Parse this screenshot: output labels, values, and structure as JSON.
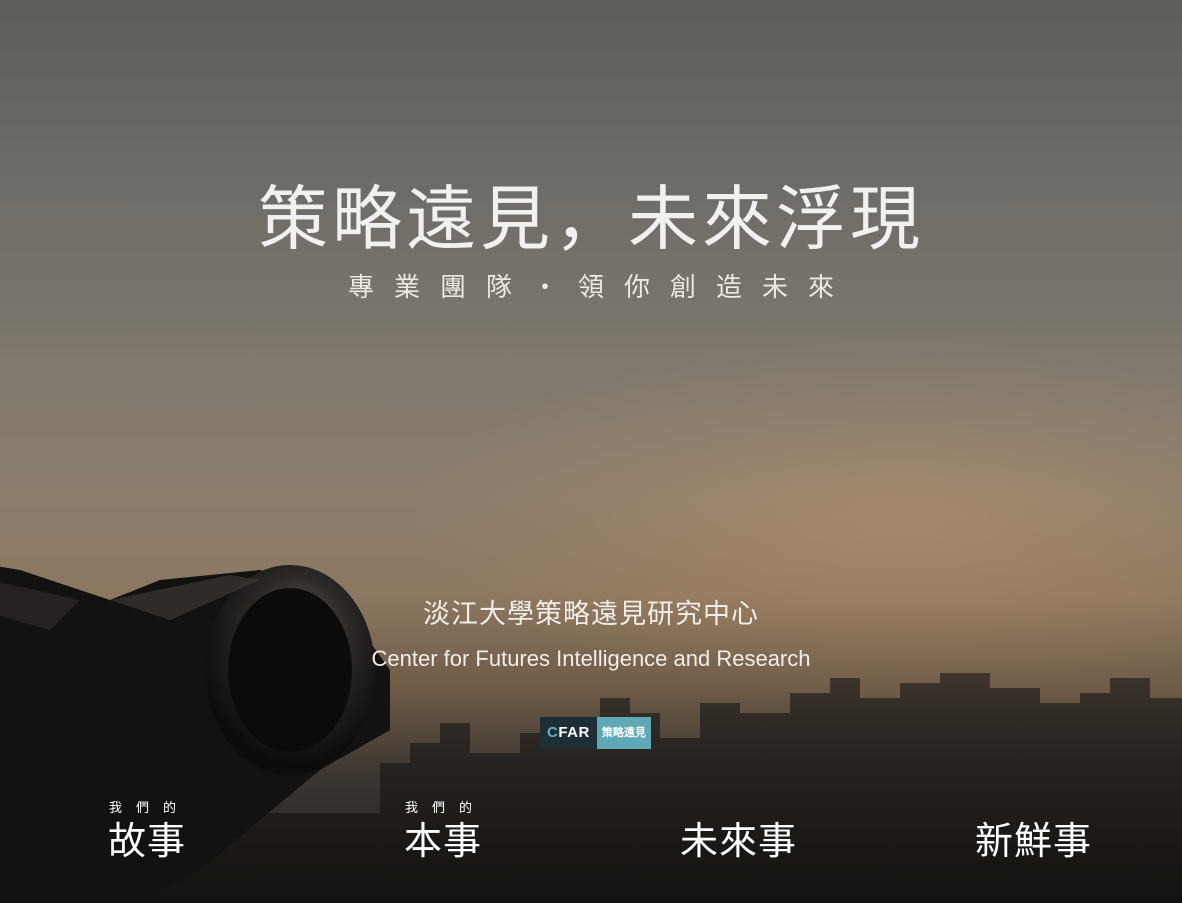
{
  "hero": {
    "title": "策略遠見，未來浮現",
    "subtitle": "專業團隊・領你創造未來"
  },
  "center": {
    "name_zh": "淡江大學策略遠見研究中心",
    "name_en": "Center for Futures Intelligence and Research"
  },
  "logo": {
    "c_letter": "C",
    "rest": "FAR",
    "right_text": "策略遠見"
  },
  "nav": {
    "items": [
      {
        "prefix": "我們的",
        "label": "故事"
      },
      {
        "prefix": "我們的",
        "label": "本事"
      },
      {
        "prefix": "",
        "label": "未來事"
      },
      {
        "prefix": "",
        "label": "新鮮事"
      }
    ]
  },
  "colors": {
    "text": "#f3f1ee",
    "logo_dark": "#1c2f34",
    "logo_accent": "#5fa9b6"
  }
}
